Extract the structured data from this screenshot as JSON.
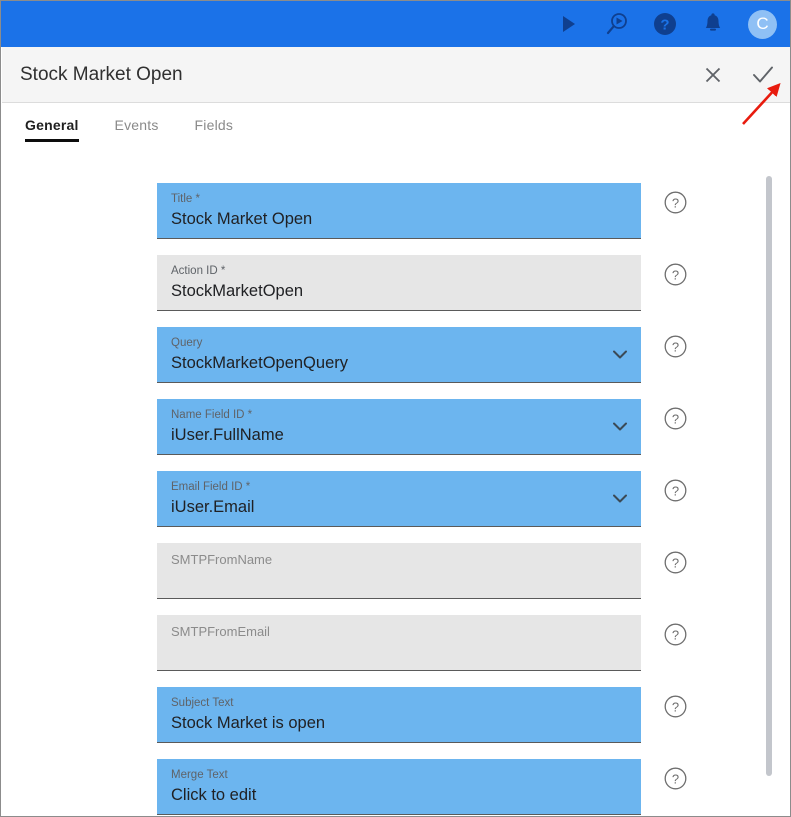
{
  "appbar": {
    "background": "#1b72e8",
    "icons": [
      {
        "name": "play-icon",
        "label": "Run"
      },
      {
        "name": "search-preview-icon",
        "label": "Preview"
      },
      {
        "name": "help-circle-icon",
        "label": "Help"
      },
      {
        "name": "bell-icon",
        "label": "Notifications"
      }
    ],
    "avatar": {
      "initial": "C",
      "background": "#8fc0f5"
    }
  },
  "dialog": {
    "title": "Stock Market Open",
    "close_label": "✕",
    "confirm_label": "✓"
  },
  "tabs": [
    {
      "label": "General",
      "active": true
    },
    {
      "label": "Events",
      "active": false
    },
    {
      "label": "Fields",
      "active": false
    }
  ],
  "form": {
    "help_glyph": "?",
    "fields": [
      {
        "label": "Title *",
        "value": "Stock Market Open",
        "state": "filled",
        "control": "text",
        "name": "title-field"
      },
      {
        "label": "Action ID *",
        "value": "StockMarketOpen",
        "state": "readonly",
        "control": "text",
        "name": "action-id-field"
      },
      {
        "label": "Query",
        "value": "StockMarketOpenQuery",
        "state": "filled",
        "control": "select",
        "name": "query-field"
      },
      {
        "label": "Name Field ID *",
        "value": "iUser.FullName",
        "state": "filled",
        "control": "select",
        "name": "name-field-id-field"
      },
      {
        "label": "Email Field ID *",
        "value": "iUser.Email",
        "state": "filled",
        "control": "select",
        "name": "email-field-id-field"
      },
      {
        "label": "SMTPFromName",
        "value": "",
        "state": "empty",
        "control": "text",
        "name": "smtp-from-name-field"
      },
      {
        "label": "SMTPFromEmail",
        "value": "",
        "state": "empty",
        "control": "text",
        "name": "smtp-from-email-field"
      },
      {
        "label": "Subject Text",
        "value": "Stock Market is open",
        "state": "filled",
        "control": "text",
        "name": "subject-text-field"
      },
      {
        "label": "Merge Text",
        "value": "Click to edit",
        "state": "filled",
        "control": "text",
        "name": "merge-text-field"
      }
    ]
  },
  "colors": {
    "appbar_blue": "#1b72e8",
    "field_filled_blue": "#6cb5ef",
    "field_empty_gray": "#e6e6e6",
    "annotation_red": "#e81b0e"
  },
  "annotation": {
    "type": "arrow",
    "color": "#e81b0e",
    "points_to": "confirm-button"
  }
}
